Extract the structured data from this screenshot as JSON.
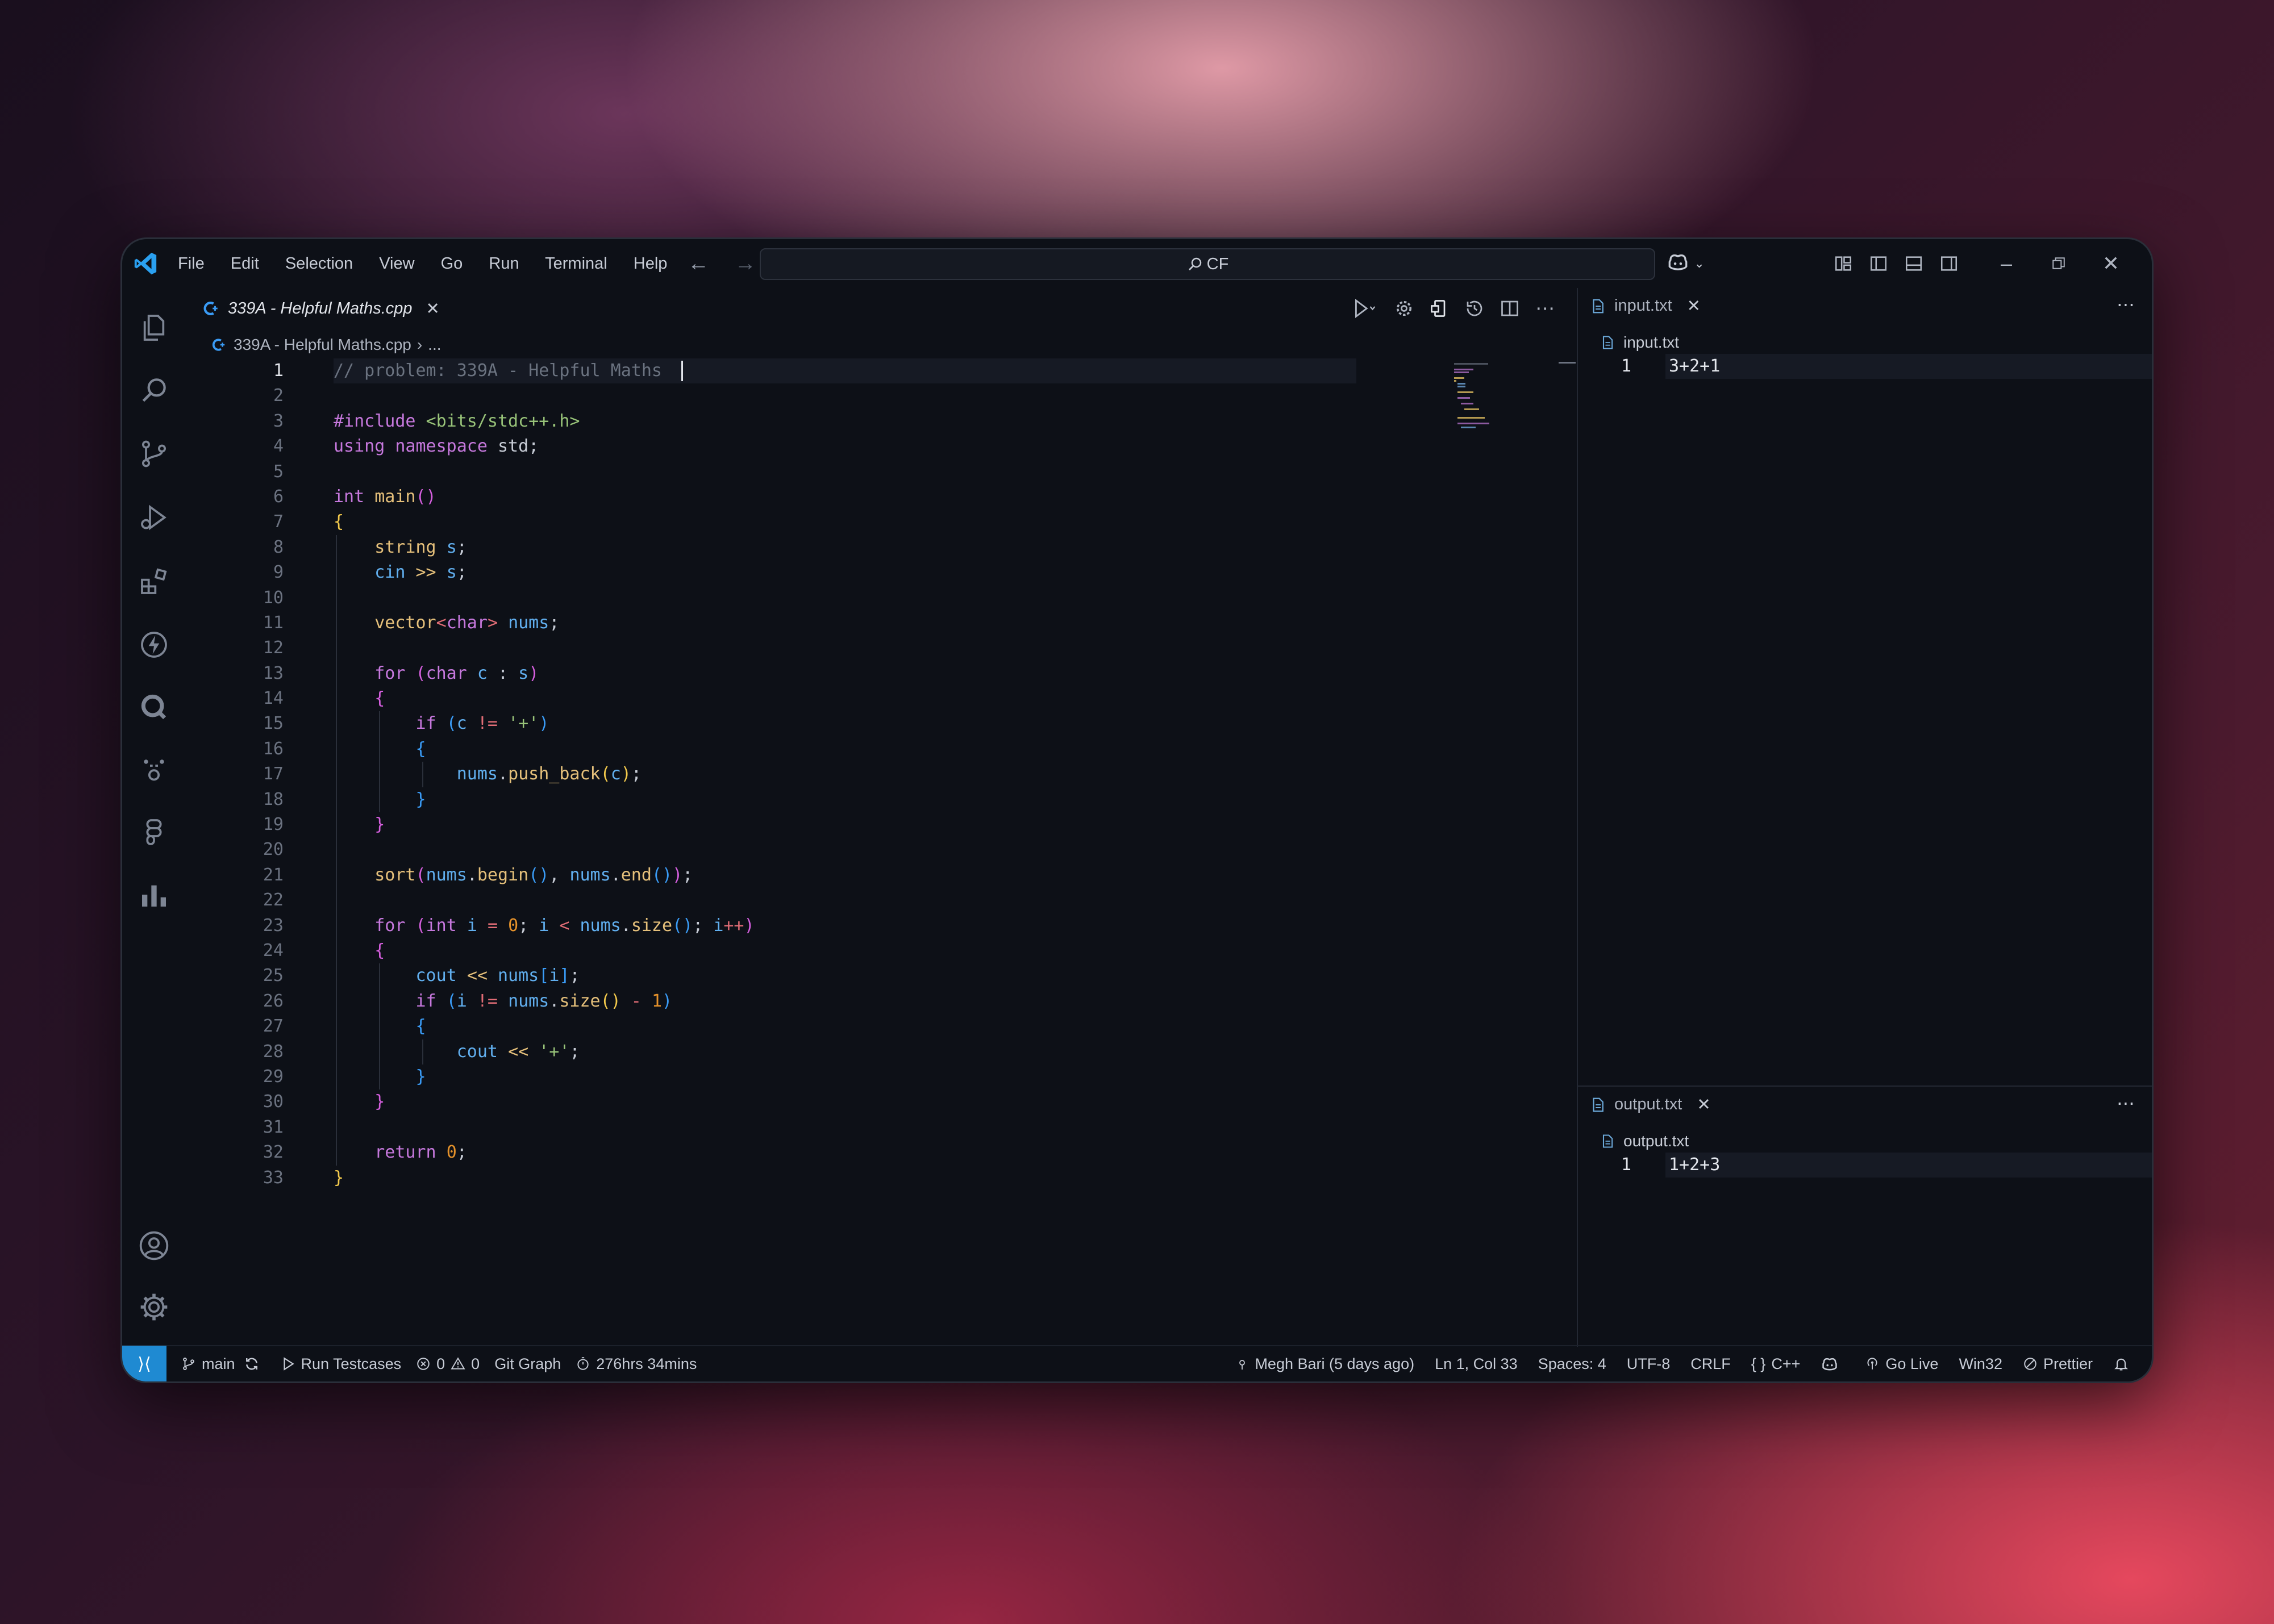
{
  "menu": [
    "File",
    "Edit",
    "Selection",
    "View",
    "Go",
    "Run",
    "Terminal",
    "Help"
  ],
  "search": {
    "value": "CF"
  },
  "editor": {
    "tab_label": "339A - Helpful Maths.cpp",
    "breadcrumb_file": "339A - Helpful Maths.cpp",
    "breadcrumb_more": "..."
  },
  "code_lines": [
    "// problem: 339A - Helpful Maths",
    "",
    "#include <bits/stdc++.h>",
    "using namespace std;",
    "",
    "int main()",
    "{",
    "    string s;",
    "    cin >> s;",
    "",
    "    vector<char> nums;",
    "",
    "    for (char c : s)",
    "    {",
    "        if (c != '+')",
    "        {",
    "            nums.push_back(c);",
    "        }",
    "    }",
    "",
    "    sort(nums.begin(), nums.end());",
    "",
    "    for (int i = 0; i < nums.size(); i++)",
    "    {",
    "        cout << nums[i];",
    "        if (i != nums.size() - 1)",
    "        {",
    "            cout << '+';",
    "        }",
    "    }",
    "",
    "    return 0;",
    "}"
  ],
  "input_panel": {
    "tab": "input.txt",
    "crumb": "input.txt",
    "line_no": "1",
    "content": "3+2+1"
  },
  "output_panel": {
    "tab": "output.txt",
    "crumb": "output.txt",
    "line_no": "1",
    "content": "1+2+3"
  },
  "status": {
    "branch": "main",
    "run_testcases": "Run Testcases",
    "errors": "0",
    "warnings": "0",
    "git_graph": "Git Graph",
    "timer": "276hrs 34mins",
    "blame": "Megh Bari (5 days ago)",
    "position": "Ln 1, Col 33",
    "spaces": "Spaces: 4",
    "encoding": "UTF-8",
    "eol": "CRLF",
    "language": "C++",
    "go_live": "Go Live",
    "platform": "Win32",
    "prettier": "Prettier"
  },
  "colors": {
    "accent": "#1f8ad2",
    "background": "#0d1017"
  }
}
